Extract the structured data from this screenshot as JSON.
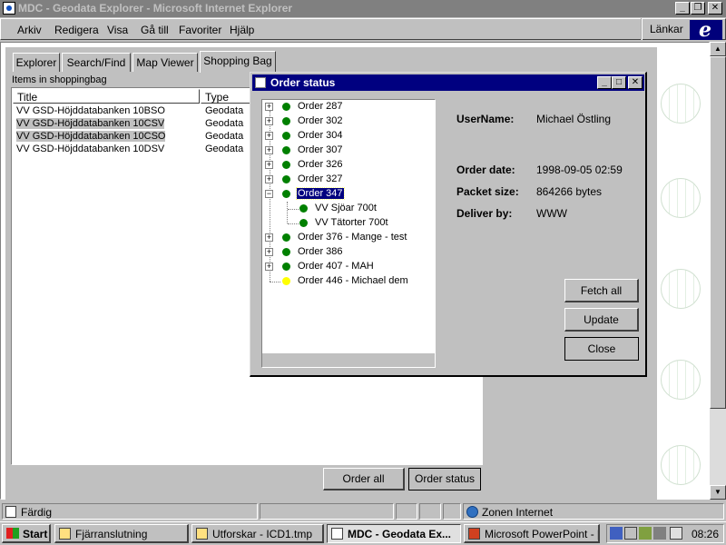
{
  "window": {
    "title": "MDC - Geodata Explorer - Microsoft Internet Explorer"
  },
  "menubar": {
    "items": [
      "Arkiv",
      "Redigera",
      "Visa",
      "Gå till",
      "Favoriter",
      "Hjälp"
    ],
    "links_label": "Länkar"
  },
  "tabs": [
    "Explorer",
    "Search/Find",
    "Map Viewer",
    "Shopping Bag"
  ],
  "active_tab": "Shopping Bag",
  "shopping_bag": {
    "heading": "Items in shoppingbag",
    "columns": [
      "Title",
      "Type"
    ],
    "rows": [
      {
        "title": "VV GSD-Höjddatabanken 10BSO",
        "type": "Geodata",
        "selected": false
      },
      {
        "title": "VV GSD-Höjddatabanken 10CSV",
        "type": "Geodata",
        "selected": true
      },
      {
        "title": "VV GSD-Höjddatabanken 10CSO",
        "type": "Geodata",
        "selected": true
      },
      {
        "title": "VV GSD-Höjddatabanken 10DSV",
        "type": "Geodata",
        "selected": false
      }
    ],
    "order_all_label": "Order all",
    "order_status_label": "Order status"
  },
  "order_dialog": {
    "title": "Order status",
    "tree": [
      {
        "label": "Order 287",
        "status": "green",
        "expanded": false,
        "selected": false
      },
      {
        "label": "Order 302",
        "status": "green",
        "expanded": false,
        "selected": false
      },
      {
        "label": "Order 304",
        "status": "green",
        "expanded": false,
        "selected": false
      },
      {
        "label": "Order 307",
        "status": "green",
        "expanded": false,
        "selected": false
      },
      {
        "label": "Order 326",
        "status": "green",
        "expanded": false,
        "selected": false
      },
      {
        "label": "Order 327",
        "status": "green",
        "expanded": false,
        "selected": false
      },
      {
        "label": "Order 347",
        "status": "green",
        "expanded": true,
        "selected": true,
        "children": [
          {
            "label": "VV Sjöar 700t",
            "status": "green"
          },
          {
            "label": "VV Tätorter 700t",
            "status": "green"
          }
        ]
      },
      {
        "label": "Order 376 - Mange - test",
        "status": "green",
        "expanded": false,
        "selected": false
      },
      {
        "label": "Order 386",
        "status": "green",
        "expanded": false,
        "selected": false
      },
      {
        "label": "Order 407 - MAH",
        "status": "green",
        "expanded": false,
        "selected": false
      },
      {
        "label": "Order 446 - Michael dem",
        "status": "yellow",
        "expanded": false,
        "selected": false
      }
    ],
    "info": {
      "username_label": "UserName:",
      "username_value": "Michael Östling",
      "order_date_label": "Order date:",
      "order_date_value": "1998-09-05 02:59",
      "packet_size_label": "Packet size:",
      "packet_size_value": "864266 bytes",
      "deliver_by_label": "Deliver by:",
      "deliver_by_value": "WWW"
    },
    "buttons": {
      "fetch_all": "Fetch all",
      "update": "Update",
      "close": "Close"
    }
  },
  "statusbar": {
    "status": "Färdig",
    "zone": "Zonen Internet"
  },
  "taskbar": {
    "start": "Start",
    "tasks": [
      {
        "label": "Fjärranslutning",
        "active": false
      },
      {
        "label": "Utforskar - ICD1.tmp",
        "active": false
      },
      {
        "label": "MDC - Geodata Ex...",
        "active": true
      },
      {
        "label": "Microsoft PowerPoint - [...",
        "active": false
      }
    ],
    "clock": "08:26"
  },
  "colors": {
    "status_green": "#008000",
    "status_yellow": "#ffff00",
    "selection": "#000080",
    "titlebar_active": "#000080",
    "titlebar_inactive": "#808080"
  }
}
